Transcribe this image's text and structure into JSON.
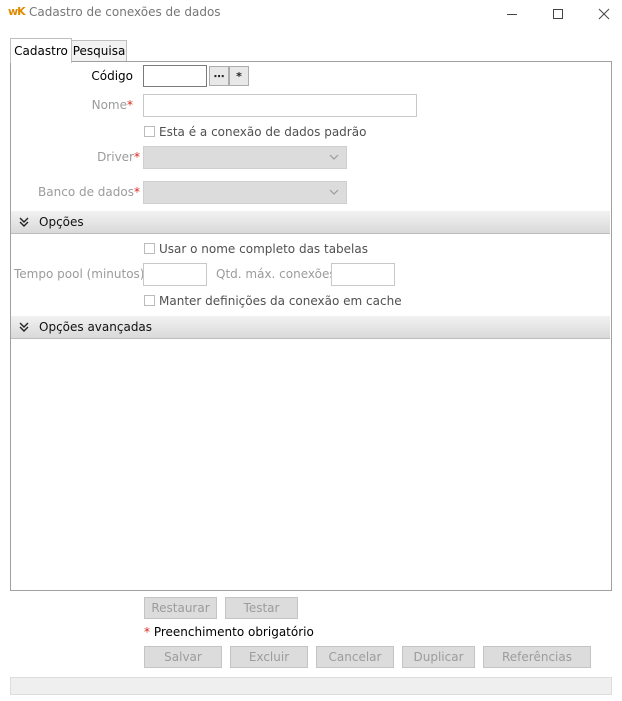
{
  "window": {
    "logo_text": "wK",
    "title": "Cadastro de conexões de dados",
    "controls": {
      "minimize": "minimize-icon",
      "maximize": "maximize-icon",
      "close": "close-icon"
    }
  },
  "tabs": [
    {
      "label": "Cadastro",
      "active": true
    },
    {
      "label": "Pesquisa",
      "active": false
    }
  ],
  "form": {
    "codigo": {
      "label": "Código",
      "value": ""
    },
    "nome": {
      "label": "Nome",
      "value": ""
    },
    "padrao_checkbox": {
      "label": "Esta é a conexão de dados padrão",
      "checked": false
    },
    "driver": {
      "label": "Driver",
      "value": ""
    },
    "banco": {
      "label": "Banco de dados",
      "value": ""
    },
    "required_mark": "*"
  },
  "sections": {
    "opcoes": {
      "title": "Opções"
    },
    "avancadas": {
      "title": "Opções avançadas"
    }
  },
  "opcoes": {
    "nome_completo": {
      "label": "Usar o nome completo das tabelas",
      "checked": false
    },
    "tempo_pool": {
      "label": "Tempo pool (minutos)",
      "value": ""
    },
    "qtd_max": {
      "label": "Qtd. máx. conexões",
      "value": ""
    },
    "manter_cache": {
      "label": "Manter definições da conexão em cache",
      "checked": false
    }
  },
  "buttons": {
    "restaurar": "Restaurar",
    "testar": "Testar",
    "salvar": "Salvar",
    "excluir": "Excluir",
    "cancelar": "Cancelar",
    "duplicar": "Duplicar",
    "referencias": "Referências"
  },
  "legend": {
    "mark": "*",
    "text": "Preenchimento obrigatório"
  },
  "colors": {
    "required": "#d9261c",
    "logo": "#e08a00",
    "disabled_text": "#9c9c9c"
  }
}
